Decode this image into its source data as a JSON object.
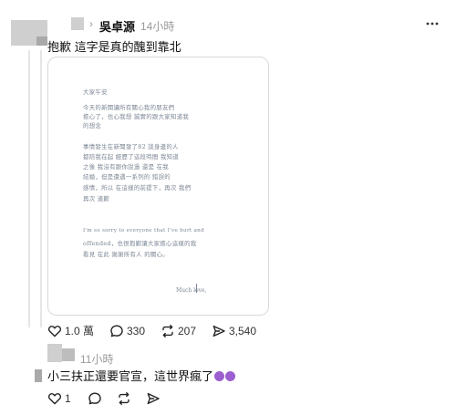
{
  "reply1": {
    "author": "吳卓源",
    "time": "14小時",
    "text": "抱歉 這字是真的醜到靠北",
    "letter_lines": [
      "大家午安",
      "今天的新聞讓所有關心我的朋友們",
      "擔心了，也心我想 誠實的跟大家知道我",
      "的想念",
      "事情發生在新聞發了82 談身邊的人",
      "都陪我在起 經歷了這段時間 我知道",
      "之後 我沒有跟你說過 還是 在我",
      "結婚，但是遭遇一系列的 錯誤的",
      "感情，所以 在這樣的前提下，再次 我們",
      "再次 道歉",
      "I'm so sorry to everyone that I've hurt and",
      "offended，也很抱歉讓大家擔心這樣的我",
      "看見 在此 謝謝所有人 的關心。"
    ],
    "signature": "Much love,",
    "stats": {
      "likes": "1.0 萬",
      "comments": "330",
      "reposts": "207",
      "shares": "3,540"
    }
  },
  "reply2": {
    "time": "11小時",
    "text": "小三扶正還要官宣，這世界瘋了",
    "emoji": [
      "devil-face",
      "devil-face"
    ],
    "stats": {
      "likes": "1"
    }
  }
}
